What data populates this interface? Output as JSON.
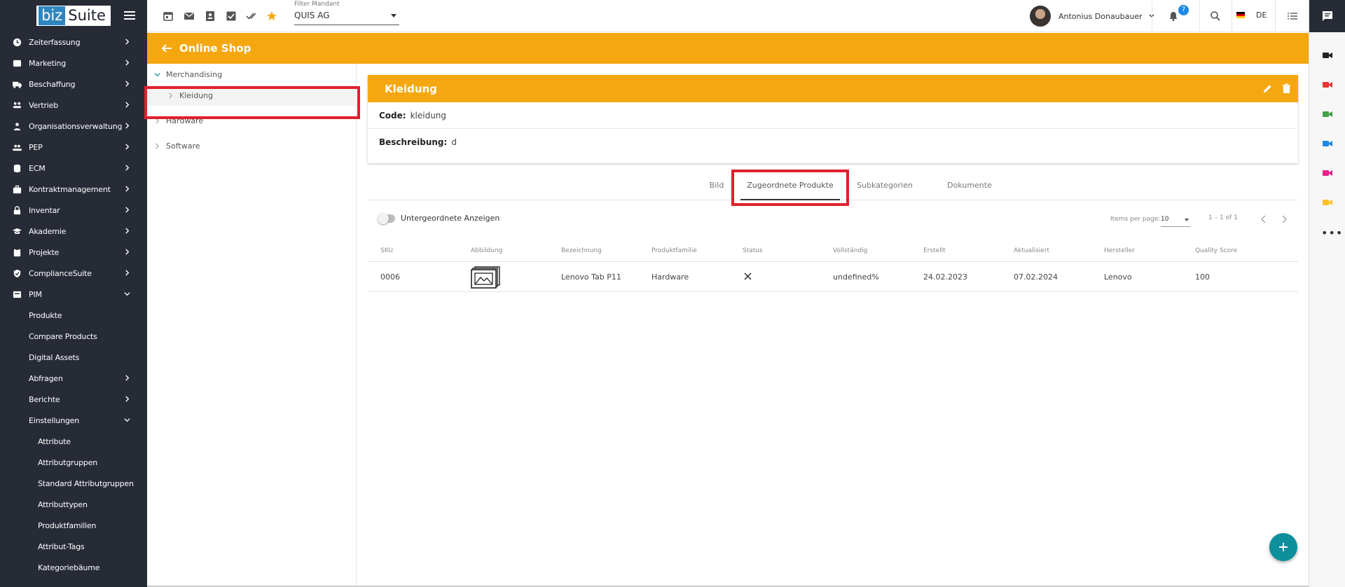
{
  "brand": {
    "logo_part1": "biz",
    "logo_part2": "Suite"
  },
  "sidebar": {
    "items": [
      {
        "label": "Zeiterfassung",
        "icon": "clock-icon"
      },
      {
        "label": "Marketing",
        "icon": "megaphone-icon"
      },
      {
        "label": "Beschaffung",
        "icon": "truck-icon"
      },
      {
        "label": "Vertrieb",
        "icon": "handshake-icon"
      },
      {
        "label": "Organisationsverwaltung",
        "icon": "org-icon"
      },
      {
        "label": "PEP",
        "icon": "people-icon"
      },
      {
        "label": "ECM",
        "icon": "database-icon"
      },
      {
        "label": "Kontraktmanagement",
        "icon": "briefcase-icon"
      },
      {
        "label": "Inventar",
        "icon": "lock-icon"
      },
      {
        "label": "Akademie",
        "icon": "graduation-cap-icon"
      },
      {
        "label": "Projekte",
        "icon": "clipboard-icon"
      },
      {
        "label": "ComplianceSuite",
        "icon": "shield-check-icon"
      },
      {
        "label": "PIM",
        "icon": "box-icon"
      }
    ],
    "pim_children": [
      {
        "label": "Produkte"
      },
      {
        "label": "Compare Products"
      },
      {
        "label": "Digital Assets"
      },
      {
        "label": "Abfragen"
      },
      {
        "label": "Berichte"
      },
      {
        "label": "Einstellungen"
      }
    ],
    "settings_children": [
      {
        "label": "Attribute"
      },
      {
        "label": "Attributgruppen"
      },
      {
        "label": "Standard Attributgruppen"
      },
      {
        "label": "Attributtypen"
      },
      {
        "label": "Produktfamilien"
      },
      {
        "label": "Attribut-Tags"
      },
      {
        "label": "Kategoriebäume"
      }
    ]
  },
  "topbar": {
    "mandant_label": "Filter Mandant",
    "mandant_value": "QUIS AG",
    "user_name": "Antonius Donaubauer",
    "notification_count": "7",
    "language": "DE"
  },
  "page": {
    "title": "Online Shop"
  },
  "tree": {
    "nodes": [
      {
        "label": "Merchandising",
        "expanded": true
      },
      {
        "label": "Kleidung",
        "selected": true
      },
      {
        "label": "Hardware"
      },
      {
        "label": "Software"
      }
    ]
  },
  "detail": {
    "title": "Kleidung",
    "code_label": "Code:",
    "code_value": "kleidung",
    "desc_label": "Beschreibung:",
    "desc_value": "d"
  },
  "tabs": [
    {
      "label": "Bild"
    },
    {
      "label": "Zugeordnete Produkte",
      "active": true
    },
    {
      "label": "Subkategorien"
    },
    {
      "label": "Dokumente"
    }
  ],
  "products": {
    "toggle_label": "Untergeordnete Anzeigen",
    "items_per_page_label": "Items per page:",
    "items_per_page": "10",
    "range_label": "1 – 1 of 1",
    "columns": [
      "SKU",
      "Abbildung",
      "Bezeichnung",
      "Produktfamilie",
      "Status",
      "Vollständig",
      "Erstellt",
      "Aktualisiert",
      "Hersteller",
      "Quality Score"
    ],
    "rows": [
      {
        "sku": "0006",
        "bezeichnung": "Lenovo Tab P11",
        "produktfamilie": "Hardware",
        "status": "x-icon",
        "vollstaendig": "undefined%",
        "erstellt": "24.02.2023",
        "aktualisiert": "07.02.2024",
        "hersteller": "Lenovo",
        "quality_score": "100"
      }
    ]
  },
  "colors": {
    "accent": "#f5a70f",
    "sidebar": "#262b36",
    "fab": "#0e8f9c",
    "highlight": "#e0202e"
  }
}
